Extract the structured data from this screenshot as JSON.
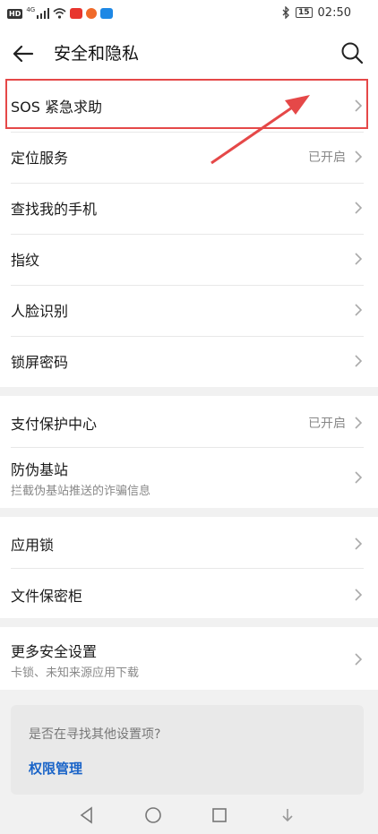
{
  "status_bar": {
    "hd": "HD",
    "net": "4G",
    "time": "02:50",
    "battery": "15"
  },
  "header": {
    "title": "安全和隐私"
  },
  "groups": [
    {
      "items": [
        {
          "label": "SOS 紧急求助"
        },
        {
          "label": "定位服务",
          "value": "已开启"
        },
        {
          "label": "查找我的手机"
        },
        {
          "label": "指纹"
        },
        {
          "label": "人脸识别"
        },
        {
          "label": "锁屏密码"
        }
      ]
    },
    {
      "items": [
        {
          "label": "支付保护中心",
          "value": "已开启"
        },
        {
          "label": "防伪基站",
          "sub": "拦截伪基站推送的诈骗信息"
        }
      ]
    },
    {
      "items": [
        {
          "label": "应用锁"
        },
        {
          "label": "文件保密柜"
        }
      ]
    },
    {
      "items": [
        {
          "label": "更多安全设置",
          "sub": "卡锁、未知来源应用下载"
        }
      ]
    }
  ],
  "suggestion": {
    "question": "是否在寻找其他设置项?",
    "link": "权限管理"
  },
  "colors": {
    "highlight": "#e54848",
    "link": "#1a64c8"
  }
}
